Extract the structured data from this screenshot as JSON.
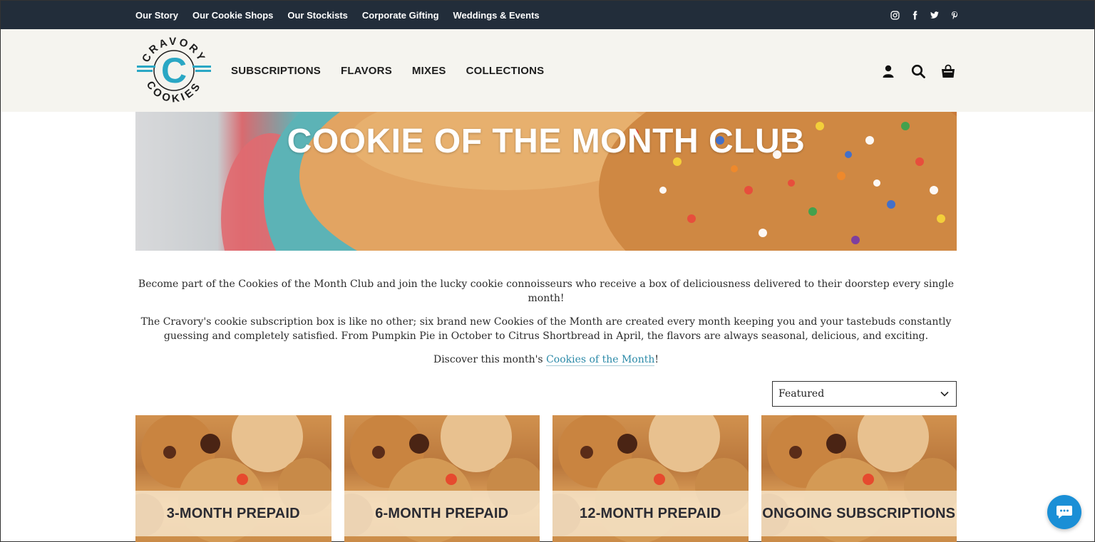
{
  "topnav": {
    "items": [
      "Our Story",
      "Our Cookie Shops",
      "Our Stockists",
      "Corporate Gifting",
      "Weddings & Events"
    ]
  },
  "social": {
    "icons": [
      "instagram-icon",
      "facebook-icon",
      "twitter-icon",
      "pinterest-icon"
    ]
  },
  "header": {
    "logo_text_top": "CRAVORY",
    "logo_text_bottom": "COOKIES",
    "logo_letter": "C",
    "nav": [
      "SUBSCRIPTIONS",
      "FLAVORS",
      "MIXES",
      "COLLECTIONS"
    ],
    "icons": [
      "account-icon",
      "search-icon",
      "cart-icon"
    ]
  },
  "hero": {
    "title": "COOKIE OF THE MONTH CLUB"
  },
  "intro": {
    "p1": "Become part of the Cookies of the Month Club and join the lucky cookie connoisseurs who receive a box of deliciousness delivered to their doorstep every single month!",
    "p2": "The Cravory's cookie subscription box is like no other; six brand new Cookies of the Month are created every month keeping you and your tastebuds constantly guessing and completely satisfied. From Pumpkin Pie in October to Citrus Shortbread in April, the flavors are always seasonal, delicious, and exciting.",
    "p3_prefix": "Discover this month's ",
    "p3_link": "Cookies of the Month",
    "p3_suffix": "!"
  },
  "sort": {
    "selected": "Featured"
  },
  "products": [
    {
      "label": "3-MONTH PREPAID"
    },
    {
      "label": "6-MONTH PREPAID"
    },
    {
      "label": "12-MONTH PREPAID"
    },
    {
      "label": "ONGOING SUBSCRIPTIONS"
    }
  ],
  "colors": {
    "topbar": "#222d3a",
    "header_bg": "#f5f4ef",
    "link": "#2b8aa8",
    "chat": "#1a8fd6",
    "logo_accent": "#2aa7c4"
  }
}
